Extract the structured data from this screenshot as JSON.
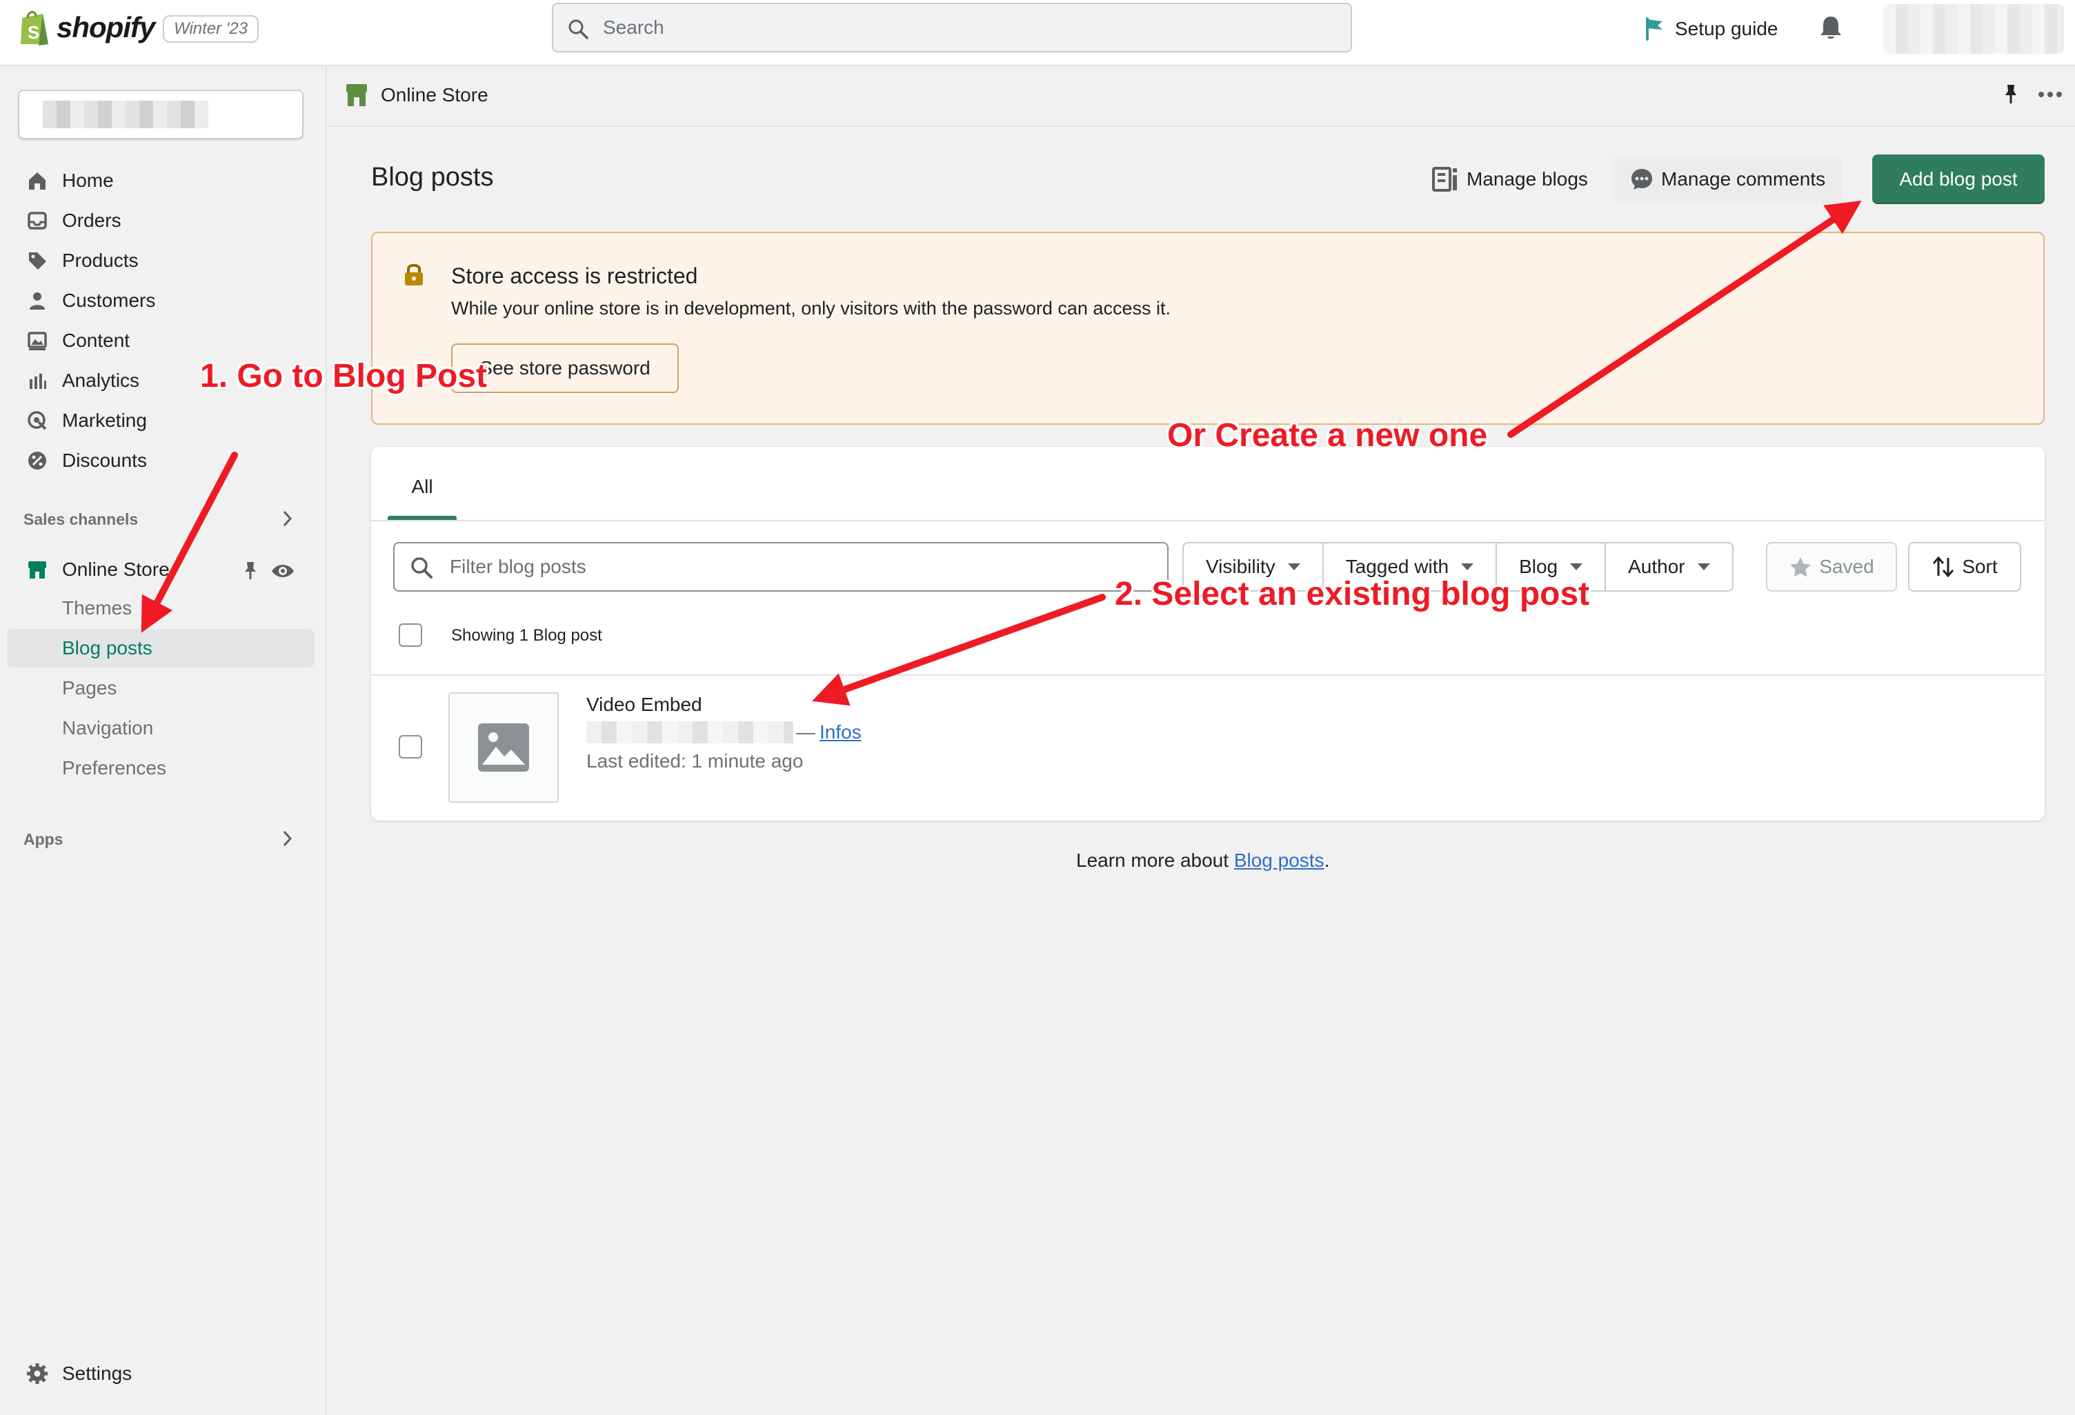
{
  "topbar": {
    "logo_text": "shopify",
    "edition": "Winter '23",
    "search_placeholder": "Search",
    "setup_guide": "Setup guide"
  },
  "sidebar": {
    "nav": [
      {
        "label": "Home",
        "icon": "home-icon"
      },
      {
        "label": "Orders",
        "icon": "orders-icon"
      },
      {
        "label": "Products",
        "icon": "tag-icon"
      },
      {
        "label": "Customers",
        "icon": "person-icon"
      },
      {
        "label": "Content",
        "icon": "image-icon"
      },
      {
        "label": "Analytics",
        "icon": "bar-chart-icon"
      },
      {
        "label": "Marketing",
        "icon": "target-icon"
      },
      {
        "label": "Discounts",
        "icon": "discount-icon"
      }
    ],
    "sales_channels_label": "Sales channels",
    "online_store": "Online Store",
    "sub_items": [
      "Themes",
      "Blog posts",
      "Pages",
      "Navigation",
      "Preferences"
    ],
    "apps_label": "Apps",
    "settings": "Settings"
  },
  "breadcrumb": {
    "label": "Online Store"
  },
  "page": {
    "title": "Blog posts",
    "manage_blogs": "Manage blogs",
    "manage_comments": "Manage comments",
    "add_blog_post": "Add blog post"
  },
  "banner": {
    "title": "Store access is restricted",
    "text": "While your online store is in development, only visitors with the password can access it.",
    "button": "See store password"
  },
  "list": {
    "tab_all": "All",
    "filter_placeholder": "Filter blog posts",
    "filters": [
      "Visibility",
      "Tagged with",
      "Blog",
      "Author"
    ],
    "saved": "Saved",
    "sort": "Sort",
    "showing": "Showing 1 Blog post",
    "post": {
      "title": "Video Embed",
      "dash": "—",
      "link": "Infos",
      "edited": "Last edited: 1 minute ago"
    }
  },
  "footer": {
    "learn_prefix": "Learn more about ",
    "learn_link": "Blog posts",
    "learn_suffix": "."
  },
  "annotations": {
    "step1": "1. Go to Blog Post",
    "step2": "2. Select an existing blog post",
    "create": "Or Create a new one"
  },
  "colors": {
    "accent": "#2f7d5c",
    "active_nav": "#007f5f",
    "annotation": "#ee1b24",
    "banner_bg": "#fdf3e9",
    "link": "#2c6ecb"
  }
}
